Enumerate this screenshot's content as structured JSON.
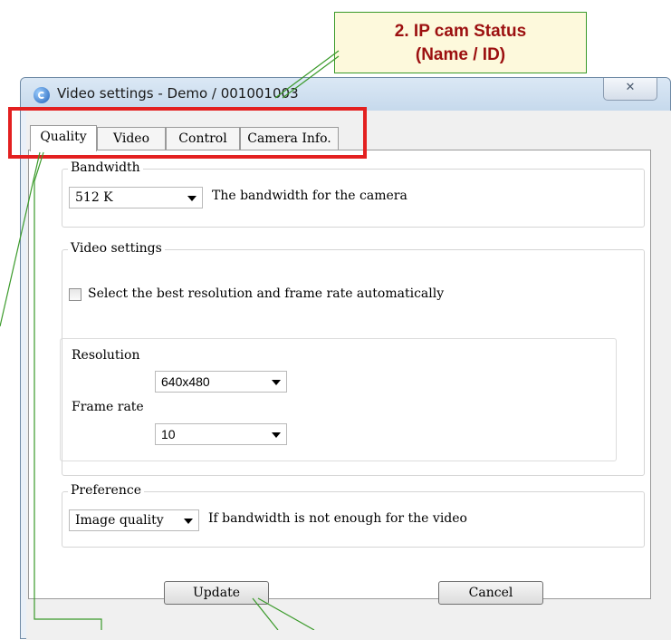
{
  "annotation": {
    "line1": "2.   IP cam Status",
    "line2": "(Name / ID)"
  },
  "window": {
    "title": "Video settings - Demo / 001001003",
    "close_glyph": "✕"
  },
  "tabs": [
    {
      "label": "Quality"
    },
    {
      "label": "Video"
    },
    {
      "label": "Control"
    },
    {
      "label": "Camera Info."
    }
  ],
  "bandwidth": {
    "group_title": "Bandwidth",
    "value": "512 K",
    "description": "The bandwidth for the camera"
  },
  "video_settings": {
    "group_title": "Video settings",
    "auto_checkbox_label": "Select the best resolution and frame rate automatically",
    "auto_checked": false,
    "resolution_label": "Resolution",
    "resolution_value": "640x480",
    "frame_rate_label": "Frame rate",
    "frame_rate_value": "10"
  },
  "preference": {
    "group_title": "Preference",
    "value": "Image quality",
    "description": "If bandwidth is not enough for the video"
  },
  "buttons": {
    "update": "Update",
    "cancel": "Cancel"
  },
  "colors": {
    "callout_text": "#9c1010",
    "callout_border": "#3a9a2a",
    "highlight": "#e32020"
  }
}
